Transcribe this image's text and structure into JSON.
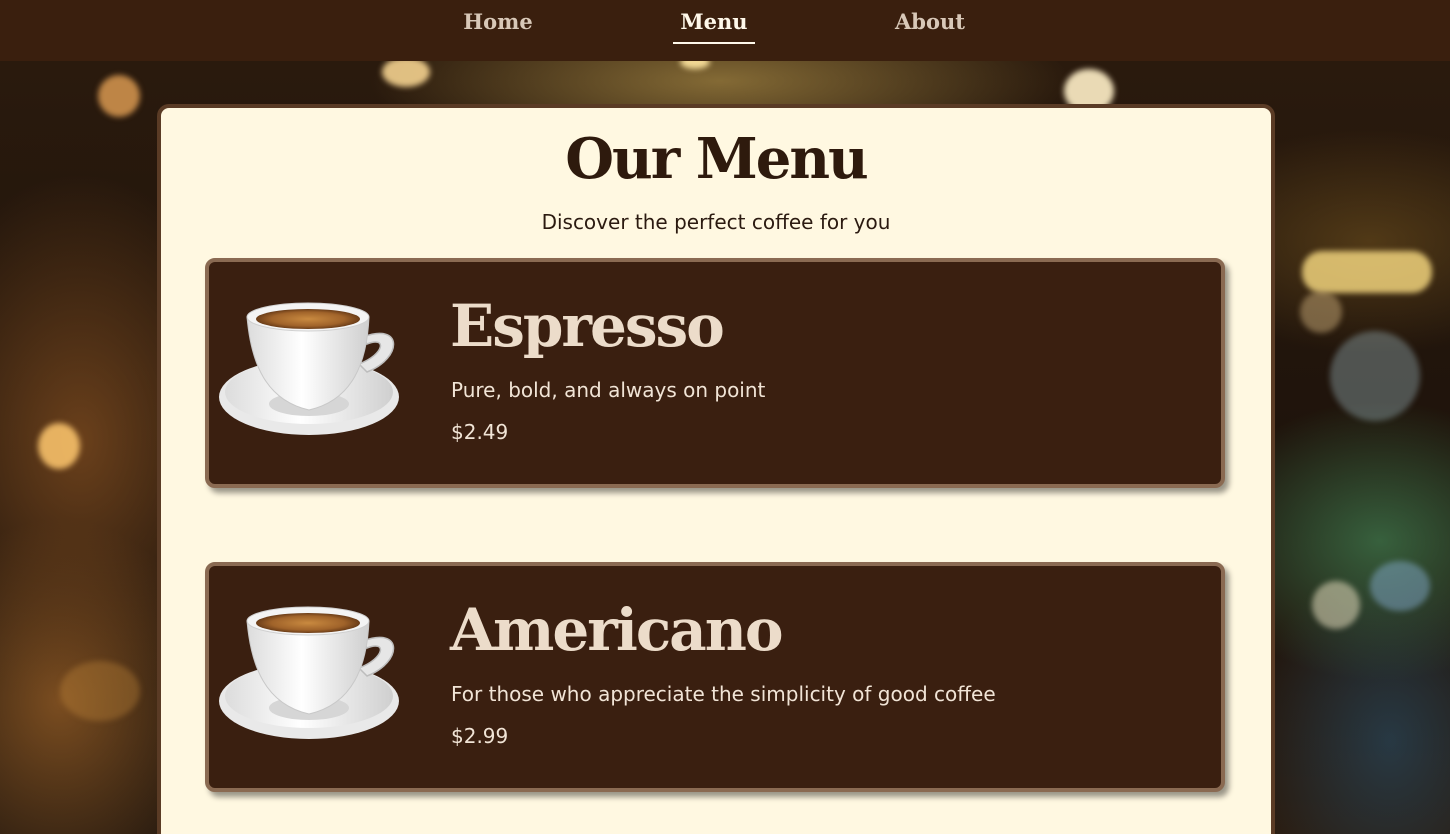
{
  "nav": {
    "items": [
      {
        "label": "Home",
        "active": false
      },
      {
        "label": "Menu",
        "active": true
      },
      {
        "label": "About",
        "active": false
      }
    ]
  },
  "page": {
    "title": "Our Menu",
    "subtitle": "Discover the perfect coffee for you"
  },
  "menu_items": [
    {
      "name": "Espresso",
      "description": "Pure, bold, and always on point",
      "price": "$2.49",
      "image_icon": "coffee-cup-icon"
    },
    {
      "name": "Americano",
      "description": "For those who appreciate the simplicity of good coffee",
      "price": "$2.99",
      "image_icon": "coffee-cup-icon"
    }
  ],
  "colors": {
    "nav_background": "#3a1f0e",
    "panel_background": "#fff8e1",
    "panel_border": "#5a3b25",
    "card_background": "#3a1f10",
    "card_border": "#8a6a52",
    "card_text": "#ecdcca",
    "title_text": "#2e1a0d"
  }
}
